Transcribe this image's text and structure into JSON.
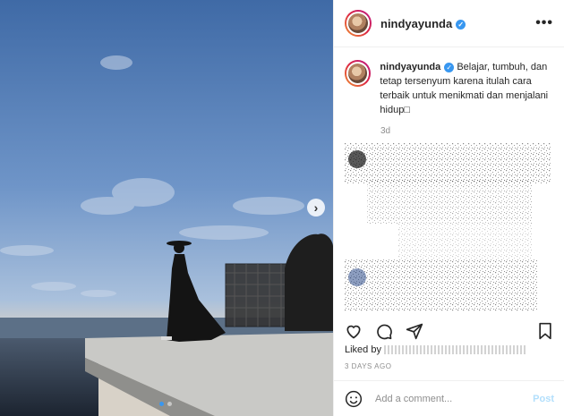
{
  "post": {
    "username": "nindyayunda",
    "verified_icon": "verified-badge-icon",
    "caption_text": "Belajar, tumbuh, dan tetap tersenyum karena itulah cara terbaik untuk menikmati dan menjalani hidup□",
    "relative_time": "3d",
    "liked_by": "Liked by",
    "posted_ago": "3 DAYS AGO",
    "carousel": {
      "current_slide": 1,
      "total_slides": 2
    }
  },
  "comment": {
    "placeholder": "Add a comment...",
    "post_label": "Post"
  },
  "icons": {
    "more": "more-options-icon",
    "next": "chevron-right-icon",
    "like": "heart-icon",
    "comment": "comment-icon",
    "share": "share-icon",
    "save": "bookmark-icon",
    "emoji": "emoji-icon"
  },
  "colors": {
    "accent": "#3897f0",
    "post_disabled": "#b2dffc",
    "muted": "#8e8e8e"
  }
}
